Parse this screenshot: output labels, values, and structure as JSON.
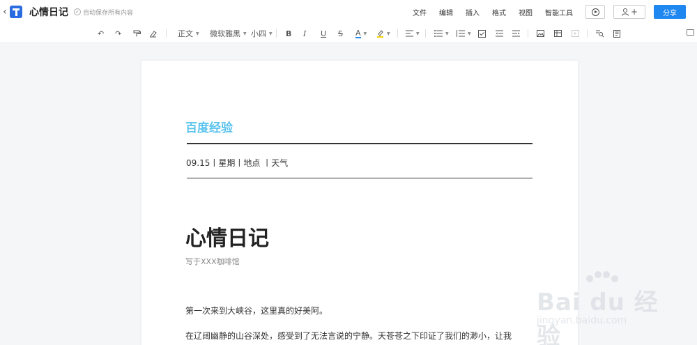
{
  "header": {
    "title": "心情日记",
    "save_status": "自动保存所有内容",
    "menus": [
      "文件",
      "编辑",
      "插入",
      "格式",
      "视图",
      "智能工具"
    ],
    "share_label": "分享",
    "add_user_label": "+"
  },
  "toolbar": {
    "paragraph_style": "正文",
    "font_family": "微软雅黑",
    "font_size": "小四",
    "bold": "B",
    "italic": "I",
    "underline": "U",
    "strike": "S",
    "font_color": "A"
  },
  "document": {
    "brand": "百度经验",
    "meta_line": "09.15丨星期丨地点 丨天气",
    "title": "心情日记",
    "subtitle": "写于XXX咖啡馆",
    "para1": "第一次来到大峡谷，这里真的好美阿。",
    "para2": "在辽阔幽静的山谷深处，感受到了无法言说的宁静。天苍苍之下印证了我们的渺小，让我"
  },
  "watermark": {
    "brand": "Bai du 经验",
    "url": "jingyan.baidu.com"
  },
  "colors": {
    "accent": "#1e88f0",
    "brand_title": "#5cc4ee"
  }
}
